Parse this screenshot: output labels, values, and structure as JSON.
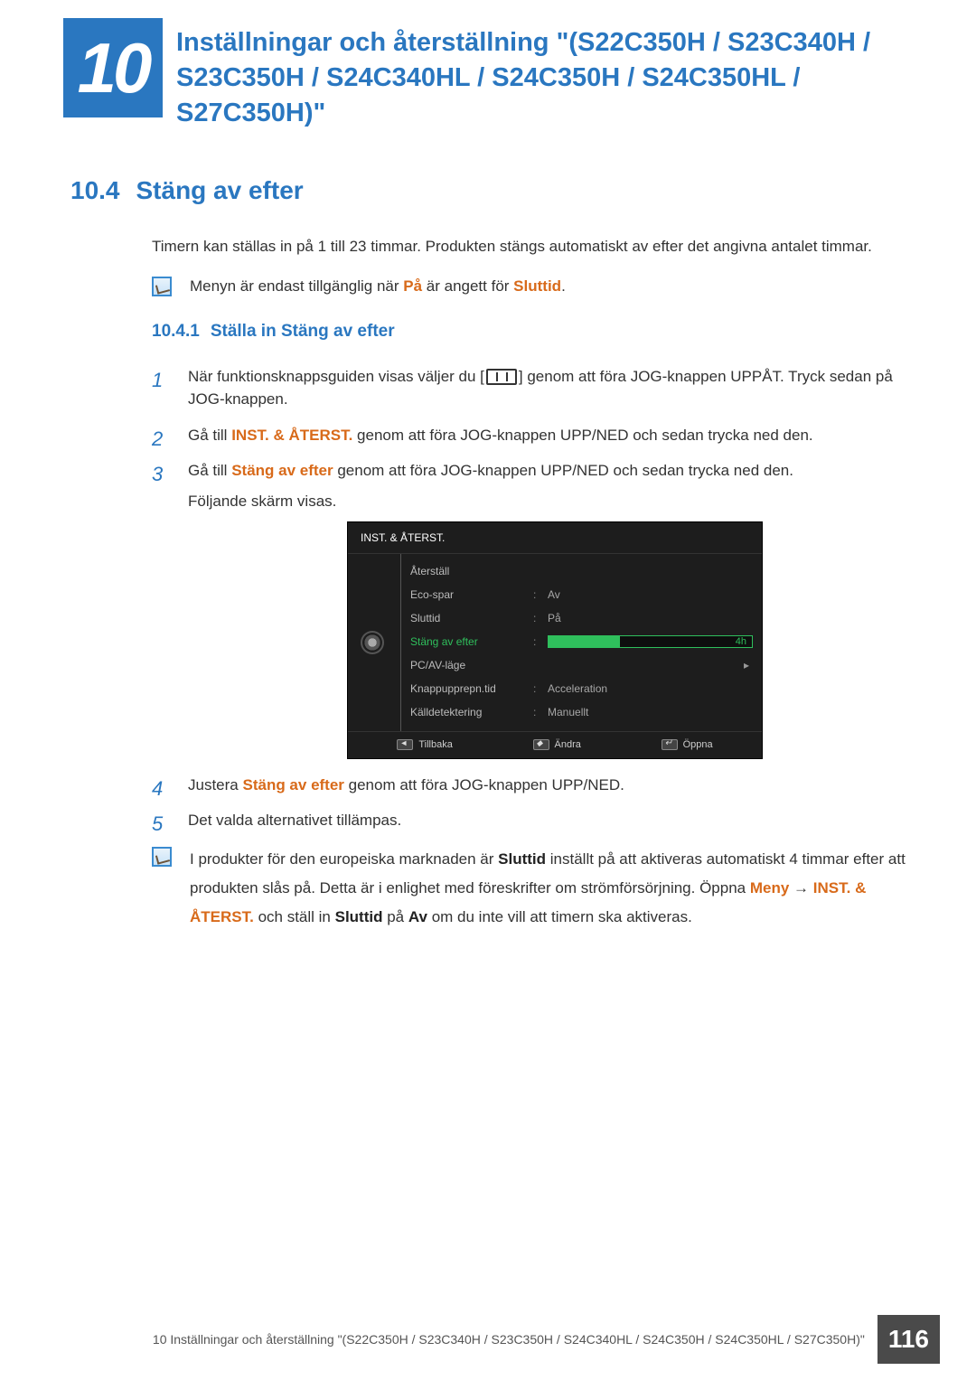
{
  "chapter": {
    "number": "10",
    "title": "Inställningar och återställning \"(S22C350H / S23C340H / S23C350H / S24C340HL / S24C350H / S24C350HL / S27C350H)\""
  },
  "section": {
    "number": "10.4",
    "title": "Stäng av efter"
  },
  "intro": "Timern kan ställas in på 1 till 23 timmar. Produkten stängs automatiskt av efter det angivna antalet timmar.",
  "note1": {
    "pre": "Menyn är endast tillgänglig när ",
    "hl1": "På",
    "mid": " är angett för ",
    "hl2": "Sluttid",
    "post": "."
  },
  "subsection": {
    "number": "10.4.1",
    "title": "Ställa in Stäng av efter"
  },
  "steps": {
    "s1a": "När funktionsknappsguiden visas väljer du [",
    "s1b": "] genom att föra JOG-knappen UPPÅT. Tryck sedan på JOG-knappen.",
    "s2a": "Gå till ",
    "s2hl": "INST. & ÅTERST.",
    "s2b": " genom att föra JOG-knappen UPP/NED och sedan trycka ned den.",
    "s3a": "Gå till ",
    "s3hl": "Stäng av efter",
    "s3b": " genom att föra JOG-knappen UPP/NED och sedan trycka ned den.",
    "s3c": "Följande skärm visas.",
    "s4a": "Justera ",
    "s4hl": "Stäng av efter",
    "s4b": " genom att föra JOG-knappen UPP/NED.",
    "s5": "Det valda alternativet tillämpas."
  },
  "osd": {
    "title": "INST. & ÅTERST.",
    "rows": [
      {
        "label": "Återställ",
        "value": ""
      },
      {
        "label": "Eco-spar",
        "value": "Av"
      },
      {
        "label": "Sluttid",
        "value": "På"
      },
      {
        "label": "Stäng av efter",
        "value": "4h",
        "selected": true
      },
      {
        "label": "PC/AV-läge",
        "value": "",
        "arrow": true
      },
      {
        "label": "Knappupprepn.tid",
        "value": "Acceleration"
      },
      {
        "label": "Källdetektering",
        "value": "Manuellt"
      }
    ],
    "footer": {
      "back": "Tillbaka",
      "adjust": "Ändra",
      "open": "Öppna"
    }
  },
  "note2": {
    "t1": "I produkter för den europeiska marknaden är ",
    "b1": "Sluttid",
    "t2": " inställt på att aktiveras automatiskt 4 timmar efter att produkten slås på. Detta är i enlighet med föreskrifter om strömförsörjning. Öppna ",
    "o1": "Meny",
    "arrow": " → ",
    "o2": "INST. & ÅTERST.",
    "t3": " och ställ in ",
    "b2": "Sluttid",
    "t4": " på ",
    "b3": "Av",
    "t5": " om du inte vill att timern ska aktiveras."
  },
  "footer": {
    "text": "10 Inställningar och återställning \"(S22C350H / S23C340H / S23C350H / S24C340HL / S24C350H / S24C350HL / S27C350H)\"",
    "page": "116"
  }
}
